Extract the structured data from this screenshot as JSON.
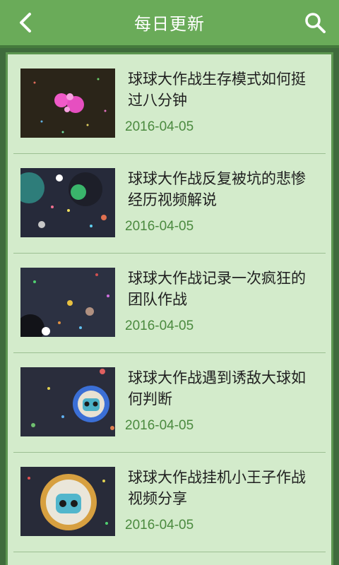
{
  "header": {
    "title": "每日更新",
    "back_icon": "chevron-left-icon",
    "search_icon": "search-icon"
  },
  "colors": {
    "header_bg": "#6aab59",
    "list_bg": "#d3ebcb",
    "frame": "#3f6b3c",
    "date_text": "#4b8a3f"
  },
  "items": [
    {
      "title": "球球大作战生存模式如何挺过八分钟",
      "date": "2016-04-05",
      "thumb": "game-screenshot-pink-balls"
    },
    {
      "title": "球球大作战反复被坑的悲惨经历视频解说",
      "date": "2016-04-05",
      "thumb": "game-screenshot-teal-balls"
    },
    {
      "title": "球球大作战记录一次疯狂的团队作战",
      "date": "2016-04-05",
      "thumb": "game-screenshot-dark-field"
    },
    {
      "title": "球球大作战遇到诱敌大球如何判断",
      "date": "2016-04-05",
      "thumb": "game-screenshot-robot-skin"
    },
    {
      "title": "球球大作战挂机小王子作战视频分享",
      "date": "2016-04-05",
      "thumb": "game-screenshot-robot-skin-closeup"
    }
  ]
}
